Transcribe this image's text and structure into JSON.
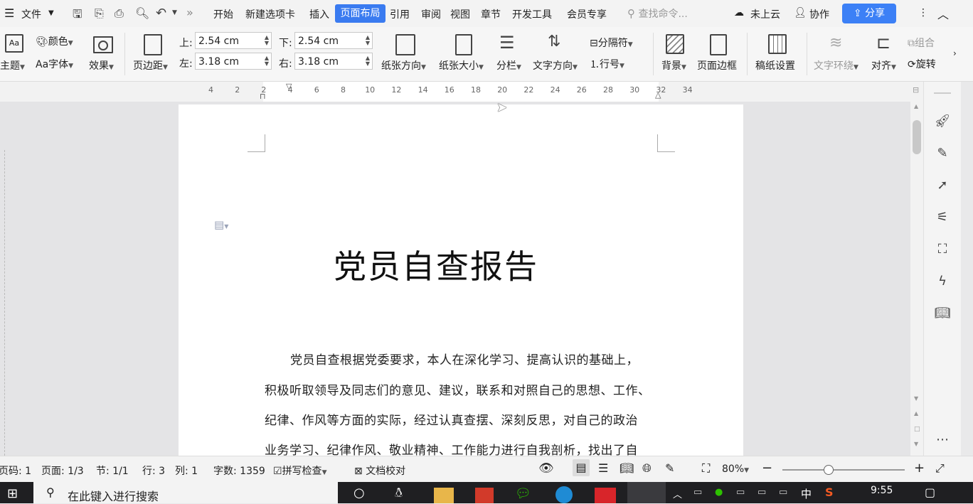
{
  "menubar": {
    "file": "文件",
    "tabs": [
      "开始",
      "新建选项卡",
      "插入",
      "页面布局",
      "引用",
      "审阅",
      "视图",
      "章节",
      "开发工具",
      "会员专享"
    ],
    "active_tab": "页面布局",
    "search_placeholder": "查找命令...",
    "cloud": "未上云",
    "collab": "协作",
    "share": "分享"
  },
  "ribbon": {
    "theme": "主题",
    "color": "颜色",
    "font": "字体",
    "effect": "效果",
    "margins": "页边距",
    "top_label": "上:",
    "top_value": "2.54 cm",
    "bottom_label": "下:",
    "bottom_value": "2.54 cm",
    "left_label": "左:",
    "left_value": "3.18 cm",
    "right_label": "右:",
    "right_value": "3.18 cm",
    "orientation": "纸张方向",
    "size": "纸张大小",
    "columns": "分栏",
    "text_direction": "文字方向",
    "separator": "分隔符",
    "line_number": "行号",
    "background": "背景",
    "page_border": "页面边框",
    "manuscript": "稿纸设置",
    "wrap": "文字环绕",
    "align": "对齐",
    "group": "组合",
    "rotate": "旋转"
  },
  "ruler_ticks": [
    "4",
    "2",
    "2",
    "4",
    "6",
    "8",
    "10",
    "12",
    "14",
    "16",
    "18",
    "20",
    "22",
    "24",
    "26",
    "28",
    "30",
    "32",
    "34"
  ],
  "document": {
    "title": "党员自查报告",
    "lines": [
      "党员自查根据党委要求，本人在深化学习、提高认识的基础上，",
      "积极听取领导及同志们的意见、建议，联系和对照自己的思想、工作、",
      "纪律、作风等方面的实际，经过认真查摆、深刻反思，对自己的政治",
      "业务学习、纪律作风、敬业精神、工作能力进行自我剖析，找出了自"
    ]
  },
  "statusbar": {
    "page_code": "页码: 1",
    "page": "页面: 1/3",
    "section": "节: 1/1",
    "row": "行: 3",
    "col": "列: 1",
    "word_count": "字数: 1359",
    "spell_check": "拼写检查",
    "proofread": "文档校对",
    "zoom": "80%"
  },
  "taskbar": {
    "search_placeholder": "在此键入进行搜索",
    "ime": "中",
    "time": "9:55"
  }
}
